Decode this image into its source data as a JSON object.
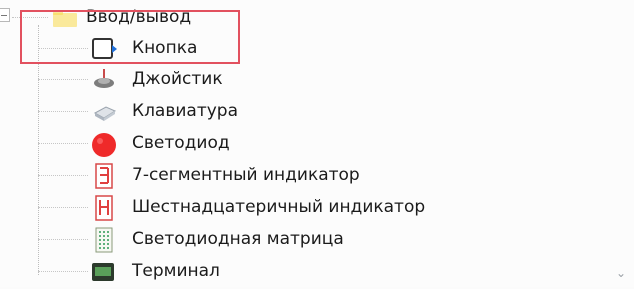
{
  "tree": {
    "root": {
      "label": "Ввод/вывод",
      "icon": "folder-icon"
    },
    "items": [
      {
        "label": "Кнопка",
        "icon": "button-icon"
      },
      {
        "label": "Джойстик",
        "icon": "joystick-icon"
      },
      {
        "label": "Клавиатура",
        "icon": "keyboard-icon"
      },
      {
        "label": "Светодиод",
        "icon": "led-icon"
      },
      {
        "label": "7-сегментный индикатор",
        "icon": "seven-segment-icon"
      },
      {
        "label": "Шестнадцатеричный индикатор",
        "icon": "hex-indicator-icon"
      },
      {
        "label": "Светодиодная матрица",
        "icon": "led-matrix-icon"
      },
      {
        "label": "Терминал",
        "icon": "terminal-icon"
      }
    ]
  },
  "colors": {
    "highlight_border": "#e2515f",
    "led_red": "#ef2a2a",
    "segment_red": "#e04040",
    "folder_yellow": "#f7d84a"
  }
}
